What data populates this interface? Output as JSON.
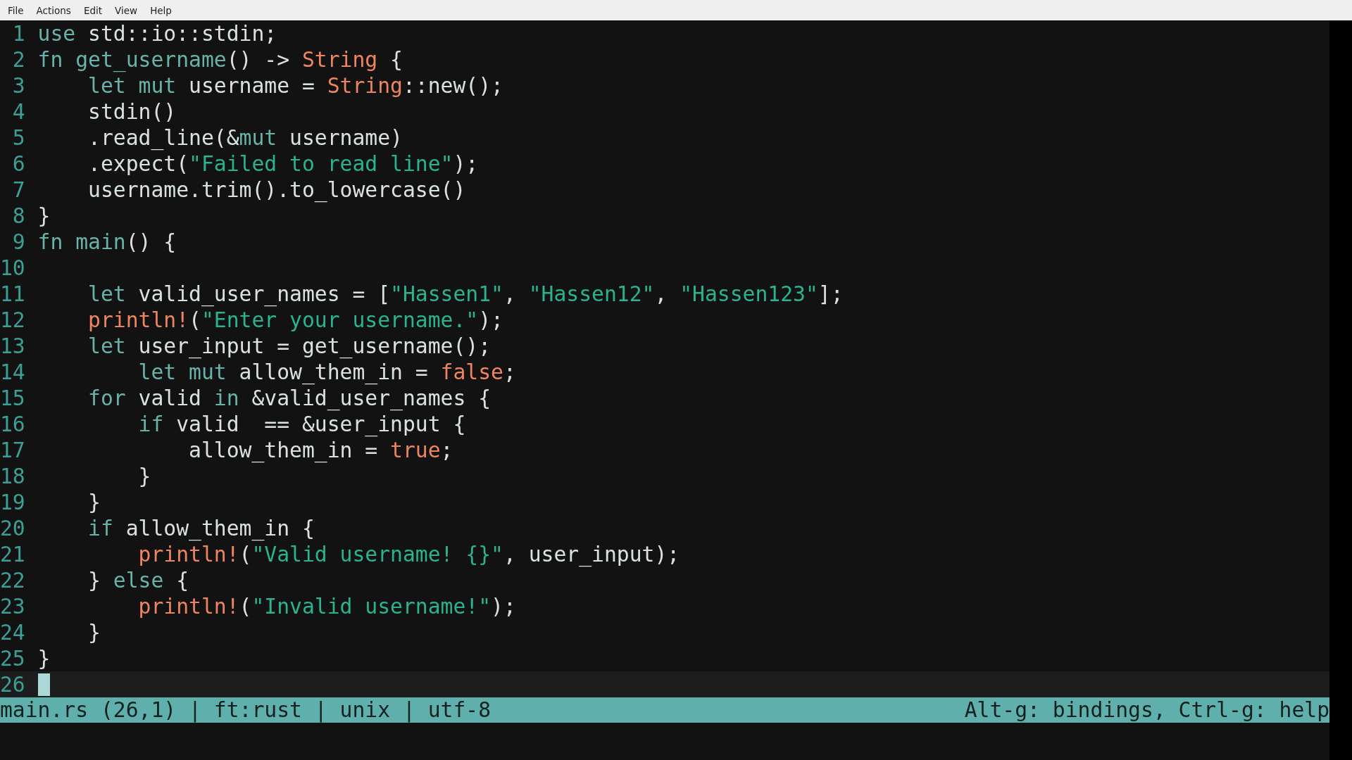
{
  "menu": [
    {
      "label": "File"
    },
    {
      "label": "Actions"
    },
    {
      "label": "Edit"
    },
    {
      "label": "View"
    },
    {
      "label": "Help"
    }
  ],
  "lines": [
    {
      "number": "1",
      "current": false,
      "segments": [
        {
          "kind": "keyword",
          "text": "use"
        },
        {
          "kind": "plain",
          "text": " std::io::stdin;"
        }
      ]
    },
    {
      "number": "2",
      "current": false,
      "segments": [
        {
          "kind": "keyword",
          "text": "fn "
        },
        {
          "kind": "keyword",
          "text": "get_username"
        },
        {
          "kind": "plain",
          "text": "() -> "
        },
        {
          "kind": "constant",
          "text": "String"
        },
        {
          "kind": "plain",
          "text": " {"
        }
      ]
    },
    {
      "number": "3",
      "current": false,
      "segments": [
        {
          "kind": "keyword",
          "text": "    let "
        },
        {
          "kind": "keyword",
          "text": "mut"
        },
        {
          "kind": "plain",
          "text": " username = "
        },
        {
          "kind": "constant",
          "text": "String"
        },
        {
          "kind": "plain",
          "text": "::new();"
        }
      ]
    },
    {
      "number": "4",
      "current": false,
      "segments": [
        {
          "kind": "plain",
          "text": "    stdin()"
        }
      ]
    },
    {
      "number": "5",
      "current": false,
      "segments": [
        {
          "kind": "plain",
          "text": "    .read_line(&"
        },
        {
          "kind": "keyword",
          "text": "mut"
        },
        {
          "kind": "plain",
          "text": " username)"
        }
      ]
    },
    {
      "number": "6",
      "current": false,
      "segments": [
        {
          "kind": "plain",
          "text": "    .expect("
        },
        {
          "kind": "string",
          "text": "\"Failed to read line\""
        },
        {
          "kind": "plain",
          "text": ");"
        }
      ]
    },
    {
      "number": "7",
      "current": false,
      "segments": [
        {
          "kind": "plain",
          "text": "    username.trim().to_lowercase()"
        }
      ]
    },
    {
      "number": "8",
      "current": false,
      "segments": [
        {
          "kind": "plain",
          "text": "}"
        }
      ]
    },
    {
      "number": "9",
      "current": false,
      "segments": [
        {
          "kind": "keyword",
          "text": "fn "
        },
        {
          "kind": "keyword",
          "text": "main"
        },
        {
          "kind": "plain",
          "text": "() {"
        }
      ]
    },
    {
      "number": "10",
      "current": false
    },
    {
      "number": "11",
      "current": false,
      "segments": [
        {
          "kind": "keyword",
          "text": "    let"
        },
        {
          "kind": "plain",
          "text": " valid_user_names = ["
        },
        {
          "kind": "string",
          "text": "\"Hassen1\""
        },
        {
          "kind": "plain",
          "text": ", "
        },
        {
          "kind": "string",
          "text": "\"Hassen12\""
        },
        {
          "kind": "plain",
          "text": ", "
        },
        {
          "kind": "string",
          "text": "\"Hassen123\""
        },
        {
          "kind": "plain",
          "text": "];"
        }
      ]
    },
    {
      "number": "12",
      "current": false,
      "segments": [
        {
          "kind": "constant",
          "text": "    println!"
        },
        {
          "kind": "plain",
          "text": "("
        },
        {
          "kind": "string",
          "text": "\"Enter your username.\""
        },
        {
          "kind": "plain",
          "text": ");"
        }
      ]
    },
    {
      "number": "13",
      "current": false,
      "segments": [
        {
          "kind": "keyword",
          "text": "    let"
        },
        {
          "kind": "plain",
          "text": " user_input = get_username();"
        }
      ]
    },
    {
      "number": "14",
      "current": false,
      "segments": [
        {
          "kind": "keyword",
          "text": "        let "
        },
        {
          "kind": "keyword",
          "text": "mut"
        },
        {
          "kind": "plain",
          "text": " allow_them_in = "
        },
        {
          "kind": "constant",
          "text": "false"
        },
        {
          "kind": "plain",
          "text": ";"
        }
      ]
    },
    {
      "number": "15",
      "current": false,
      "segments": [
        {
          "kind": "keyword",
          "text": "    for"
        },
        {
          "kind": "plain",
          "text": " valid "
        },
        {
          "kind": "keyword",
          "text": "in"
        },
        {
          "kind": "plain",
          "text": " &valid_user_names {"
        }
      ]
    },
    {
      "number": "16",
      "current": false,
      "segments": [
        {
          "kind": "keyword",
          "text": "        if"
        },
        {
          "kind": "plain",
          "text": " valid  == &user_input {"
        }
      ]
    },
    {
      "number": "17",
      "current": false,
      "segments": [
        {
          "kind": "plain",
          "text": "            allow_them_in = "
        },
        {
          "kind": "constant",
          "text": "true"
        },
        {
          "kind": "plain",
          "text": ";"
        }
      ]
    },
    {
      "number": "18",
      "current": false,
      "segments": [
        {
          "kind": "plain",
          "text": "        }"
        }
      ]
    },
    {
      "number": "19",
      "current": false,
      "segments": [
        {
          "kind": "plain",
          "text": "    }"
        }
      ]
    },
    {
      "number": "20",
      "current": false,
      "segments": [
        {
          "kind": "keyword",
          "text": "    if"
        },
        {
          "kind": "plain",
          "text": " allow_them_in {"
        }
      ]
    },
    {
      "number": "21",
      "current": false,
      "segments": [
        {
          "kind": "constant",
          "text": "        println!"
        },
        {
          "kind": "plain",
          "text": "("
        },
        {
          "kind": "string",
          "text": "\"Valid username! {}\""
        },
        {
          "kind": "plain",
          "text": ", user_input);"
        }
      ]
    },
    {
      "number": "22",
      "current": false,
      "segments": [
        {
          "kind": "plain",
          "text": "    } "
        },
        {
          "kind": "keyword",
          "text": "else"
        },
        {
          "kind": "plain",
          "text": " {"
        }
      ]
    },
    {
      "number": "23",
      "current": false,
      "segments": [
        {
          "kind": "constant",
          "text": "        println!"
        },
        {
          "kind": "plain",
          "text": "("
        },
        {
          "kind": "string",
          "text": "\"Invalid username!\""
        },
        {
          "kind": "plain",
          "text": ");"
        }
      ]
    },
    {
      "number": "24",
      "current": false,
      "segments": [
        {
          "kind": "plain",
          "text": "    }"
        }
      ]
    },
    {
      "number": "25",
      "current": false,
      "segments": [
        {
          "kind": "plain",
          "text": "}"
        }
      ]
    },
    {
      "number": "26",
      "current": true
    }
  ],
  "status_bar": {
    "left": "main.rs (26,1) | ft:rust | unix | utf-8",
    "right": "Alt-g: bindings, Ctrl-g: help"
  }
}
